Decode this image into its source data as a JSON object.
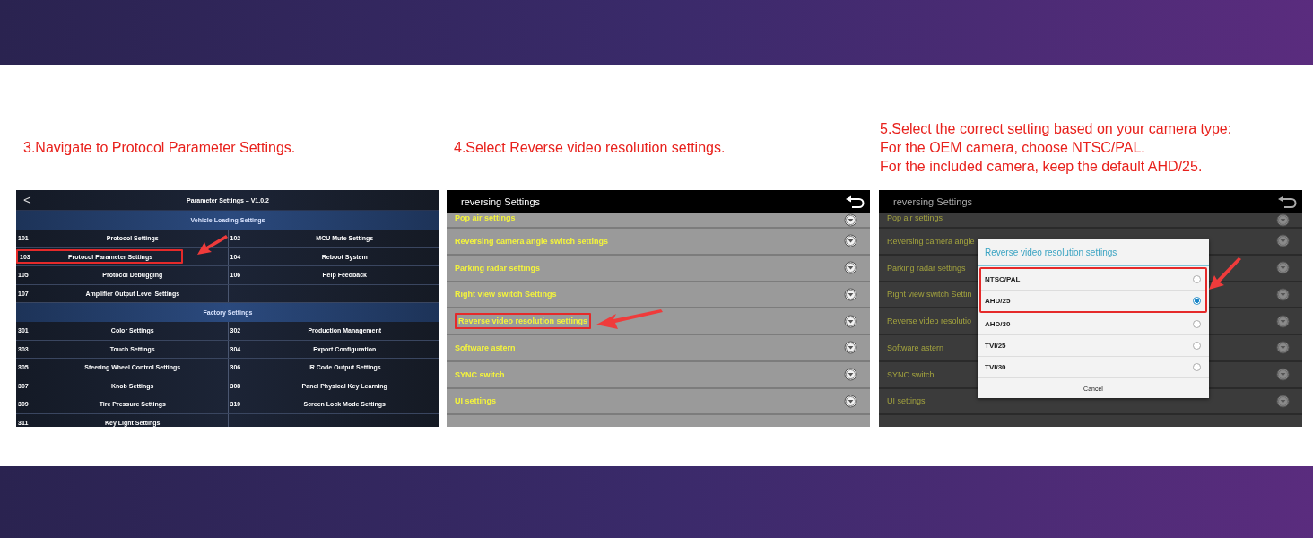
{
  "steps": [
    {
      "caption": [
        "3.Navigate to Protocol Parameter Settings."
      ],
      "screen": {
        "kind": "parameter_grid",
        "title": "Parameter Settings – V1.0.2",
        "back": "<",
        "sections": [
          {
            "title": "Vehicle Loading Settings",
            "rows": [
              [
                {
                  "code": "101",
                  "label": "Protocol Settings",
                  "highlighted": false
                },
                {
                  "code": "102",
                  "label": "MCU Mute Settings",
                  "highlighted": false
                }
              ],
              [
                {
                  "code": "103",
                  "label": "Protocol Parameter Settings",
                  "highlighted": true
                },
                {
                  "code": "104",
                  "label": "Reboot System",
                  "highlighted": false
                }
              ],
              [
                {
                  "code": "105",
                  "label": "Protocol Debugging",
                  "highlighted": false
                },
                {
                  "code": "106",
                  "label": "Help Feedback",
                  "highlighted": false
                }
              ],
              [
                {
                  "code": "107",
                  "label": "Amplifier Output Level Settings",
                  "highlighted": false
                }
              ]
            ]
          },
          {
            "title": "Factory Settings",
            "rows": [
              [
                {
                  "code": "301",
                  "label": "Color Settings",
                  "highlighted": false
                },
                {
                  "code": "302",
                  "label": "Production Management",
                  "highlighted": false
                }
              ],
              [
                {
                  "code": "303",
                  "label": "Touch Settings",
                  "highlighted": false
                },
                {
                  "code": "304",
                  "label": "Export Configuration",
                  "highlighted": false
                }
              ],
              [
                {
                  "code": "305",
                  "label": "Steering Wheel Control Settings",
                  "highlighted": false
                },
                {
                  "code": "306",
                  "label": "IR Code Output Settings",
                  "highlighted": false
                }
              ],
              [
                {
                  "code": "307",
                  "label": "Knob Settings",
                  "highlighted": false
                },
                {
                  "code": "308",
                  "label": "Panel Physical Key Learning",
                  "highlighted": false
                }
              ],
              [
                {
                  "code": "309",
                  "label": "Tire Pressure Settings",
                  "highlighted": false
                },
                {
                  "code": "310",
                  "label": "Screen Lock Mode Settings",
                  "highlighted": false
                }
              ],
              [
                {
                  "code": "311",
                  "label": "Key Light Settings",
                  "highlighted": false
                }
              ]
            ]
          }
        ]
      }
    },
    {
      "caption": [
        "4.Select Reverse video resolution settings."
      ],
      "screen": {
        "kind": "settings_list",
        "title": "reversing Settings",
        "dimmed": false,
        "items": [
          {
            "label": "Pop air settings",
            "highlighted": false
          },
          {
            "label": "Reversing camera angle switch settings",
            "highlighted": false
          },
          {
            "label": "Parking radar settings",
            "highlighted": false
          },
          {
            "label": "Right view switch Settings",
            "highlighted": false
          },
          {
            "label": "Reverse video resolution settings",
            "highlighted": true
          },
          {
            "label": "Software astern",
            "highlighted": false
          },
          {
            "label": "SYNC switch",
            "highlighted": false
          },
          {
            "label": "UI settings",
            "highlighted": false
          }
        ]
      }
    },
    {
      "caption": [
        "5.Select the correct setting based on your camera type:",
        "For the OEM camera, choose NTSC/PAL.",
        "For the included camera, keep the default AHD/25."
      ],
      "screen": {
        "kind": "settings_list",
        "title": "reversing Settings",
        "dimmed": true,
        "items": [
          {
            "label": "Pop air settings",
            "highlighted": false
          },
          {
            "label": "Reversing camera angle",
            "highlighted": false
          },
          {
            "label": "Parking radar settings",
            "highlighted": false
          },
          {
            "label": "Right view switch Settin",
            "highlighted": false
          },
          {
            "label": "Reverse video resolutio",
            "highlighted": false
          },
          {
            "label": "Software astern",
            "highlighted": false
          },
          {
            "label": "SYNC switch",
            "highlighted": false
          },
          {
            "label": "UI settings",
            "highlighted": false
          }
        ],
        "dialog": {
          "title": "Reverse video resolution settings",
          "options": [
            {
              "label": "NTSC/PAL",
              "selected": false,
              "highlighted": true
            },
            {
              "label": "AHD/25",
              "selected": true,
              "highlighted": true
            },
            {
              "label": "AHD/30",
              "selected": false,
              "highlighted": false
            },
            {
              "label": "TVI/25",
              "selected": false,
              "highlighted": false
            },
            {
              "label": "TVI/30",
              "selected": false,
              "highlighted": false
            }
          ],
          "cancel": "Cancel"
        }
      }
    }
  ]
}
